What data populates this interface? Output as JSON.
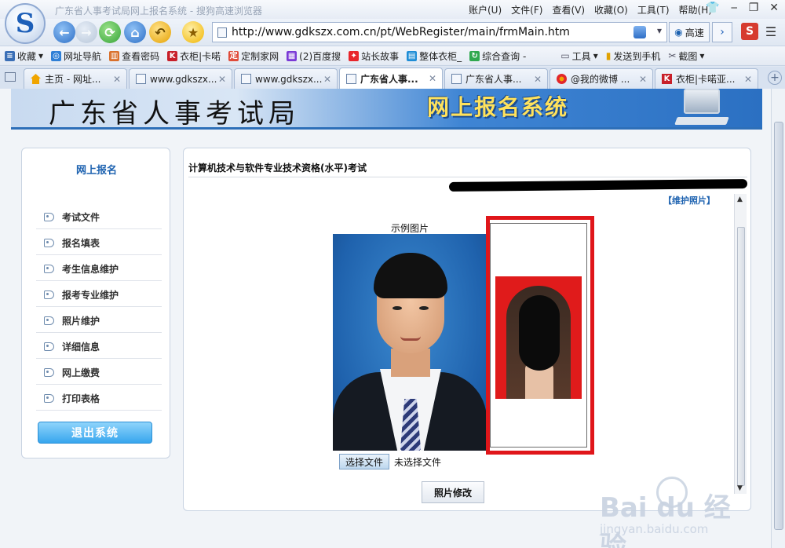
{
  "window": {
    "title": "广东省人事考试局网上报名系统 - 搜狗高速浏览器",
    "menu": [
      "账户(U)",
      "文件(F)",
      "查看(V)",
      "收藏(O)",
      "工具(T)",
      "帮助(H)"
    ]
  },
  "navbar": {
    "url": "http://www.gdkszx.com.cn/pt/WebRegister/main/frmMain.htm",
    "speed_label": "高速",
    "s_logo": "S"
  },
  "favorites": {
    "items": [
      "收藏",
      "网址导航",
      "查看密码",
      "衣柜|卡喏",
      "定制家网",
      "(2)百度搜",
      "站长故事",
      "整体衣柜_",
      "综合查询 -"
    ],
    "right_items": [
      "工具",
      "发送到手机",
      "截图"
    ]
  },
  "tabs": [
    {
      "label": "主页 - 网址...",
      "active": false
    },
    {
      "label": "www.gdkszx....",
      "active": false
    },
    {
      "label": "www.gdkszx....",
      "active": false
    },
    {
      "label": "广东省人事...",
      "active": true
    },
    {
      "label": "广东省人事...",
      "active": false
    },
    {
      "label": "@我的微博 ...",
      "active": false
    },
    {
      "label": "衣柜|卡喏亚...",
      "active": false
    }
  ],
  "banner": {
    "title": "广东省人事考试局",
    "system": "网上报名系统"
  },
  "sidebar": {
    "title": "网上报名",
    "items": [
      "考试文件",
      "报名填表",
      "考生信息维护",
      "报考专业维护",
      "照片维护",
      "详细信息",
      "网上缴费",
      "打印表格"
    ],
    "logout": "退出系统"
  },
  "main": {
    "heading": "计算机技术与软件专业技术资格(水平)考试",
    "maintain_link": "【维护照片】",
    "sample_label": "示例图片",
    "file_button": "选择文件",
    "file_status": "未选择文件",
    "modify_button": "照片修改"
  },
  "watermark": {
    "brand": "Bai du 经验",
    "url": "jingyan.baidu.com"
  },
  "colors": {
    "accent_blue": "#1d62b0",
    "highlight_red": "#e0161a",
    "banner_yellow": "#ffe25c"
  }
}
